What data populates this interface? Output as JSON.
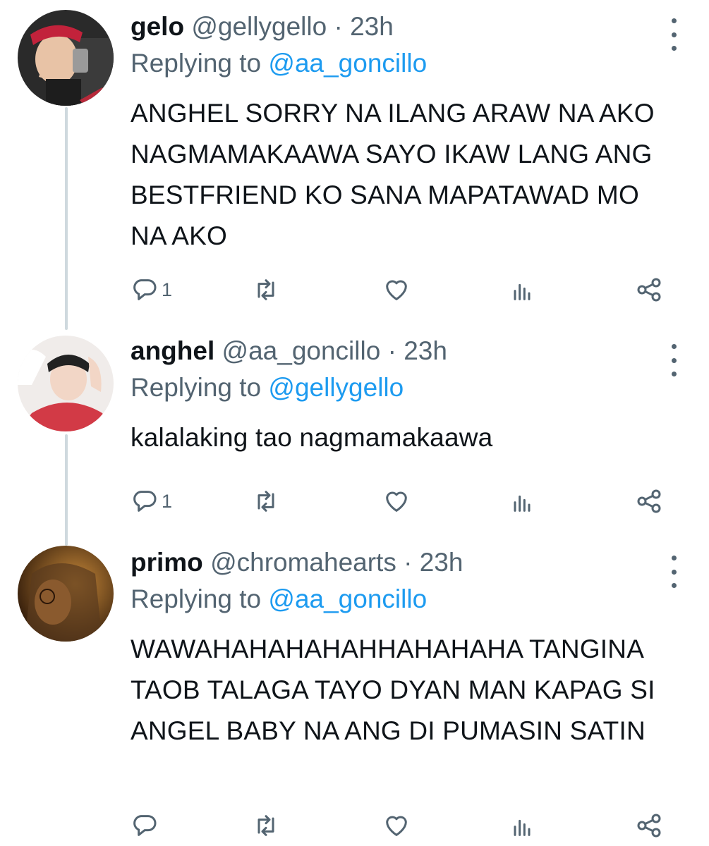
{
  "tweets": [
    {
      "name": "gelo",
      "handle": "@gellygello",
      "separator": "·",
      "time": "23h",
      "replying_prefix": "Replying to",
      "replying_to": "@aa_goncillo",
      "text": "ANGHEL SORRY NA ILANG ARAW NA AKO NAGMAMAKAAWA SAYO IKAW LANG ANG BESTFRIEND KO SANA MAPATAWAD MO NA AKO",
      "reply_count": "1",
      "avatar_colors": {
        "bg": "#2a2a2a",
        "accent": "#c2223b",
        "skin": "#e8c3a6"
      }
    },
    {
      "name": "anghel",
      "handle": "@aa_goncillo",
      "separator": "·",
      "time": "23h",
      "replying_prefix": "Replying to",
      "replying_to": "@gellygello",
      "text": "kalalaking tao nagmamakaawa",
      "reply_count": "1",
      "avatar_colors": {
        "bg": "#f0ecea",
        "accent": "#d23a46",
        "skin": "#f2d6c6"
      }
    },
    {
      "name": "primo",
      "handle": "@chromahearts",
      "separator": "·",
      "time": "23h",
      "replying_prefix": "Replying to",
      "replying_to": "@aa_goncillo",
      "text": "WAWAHAHAHAHAHHAHAHAHA TANGINA TAOB TALAGA TAYO DYAN MAN KAPAG SI ANGEL BABY NA ANG DI PUMASIN SATIN",
      "reply_count": "",
      "avatar_colors": {
        "bg": "#3a2412",
        "accent": "#c98a3a",
        "skin": "#8a5a2e"
      }
    }
  ],
  "icons": {
    "reply": "reply-icon",
    "retweet": "retweet-icon",
    "like": "heart-icon",
    "views": "views-icon",
    "share": "share-icon",
    "more": "more-icon"
  },
  "colors": {
    "text": "#0f1419",
    "secondary": "#536471",
    "link": "#1d9bf0",
    "thread_line": "#cfd9de"
  }
}
